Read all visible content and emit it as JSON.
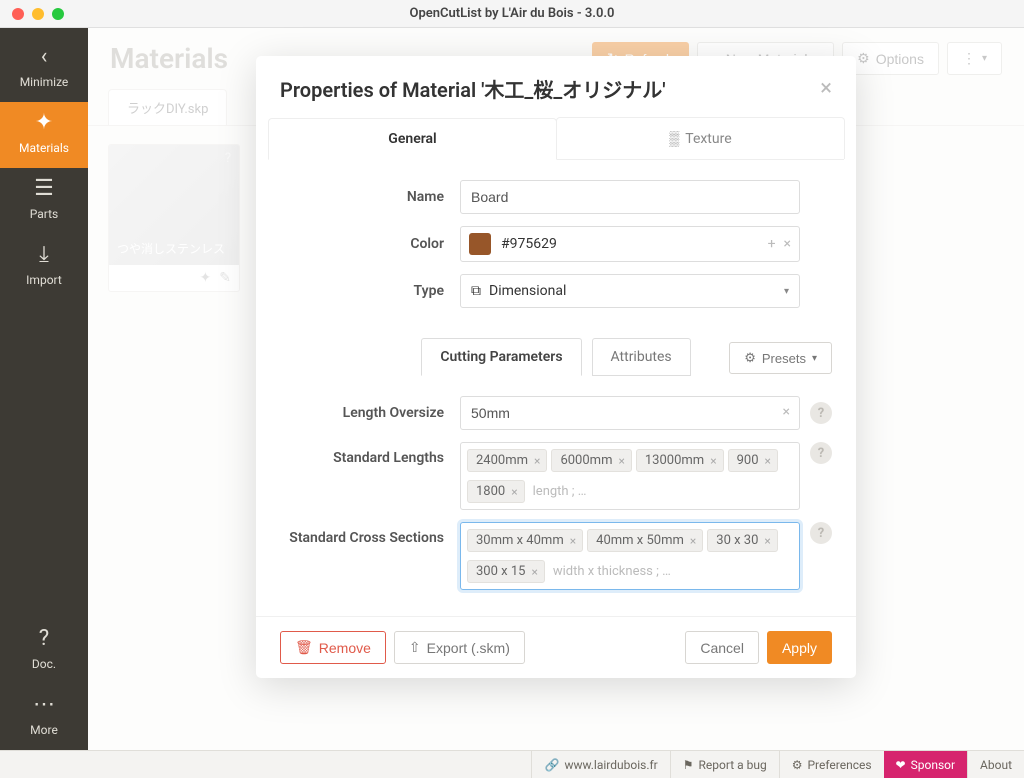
{
  "window": {
    "title": "OpenCutList by L'Air du Bois - 3.0.0"
  },
  "sidebar": {
    "minimize": "Minimize",
    "materials": "Materials",
    "parts": "Parts",
    "import": "Import",
    "doc": "Doc.",
    "more": "More"
  },
  "page": {
    "title": "Materials",
    "refresh": "Refresh",
    "new_material": "New Material...",
    "options": "Options",
    "file_tab": "ラックDIY.skp",
    "material_card_label": "つや消しステンレス"
  },
  "modal": {
    "title": "Properties of Material '木工_桜_オリジナル'",
    "tabs": {
      "general": "General",
      "texture": "Texture"
    },
    "labels": {
      "name": "Name",
      "color": "Color",
      "type": "Type",
      "length_oversize": "Length Oversize",
      "std_lengths": "Standard Lengths",
      "std_cross": "Standard Cross Sections"
    },
    "values": {
      "name": "Board",
      "color_hex": "#975629",
      "type": "Dimensional",
      "length_oversize": "50mm"
    },
    "subtabs": {
      "cutting": "Cutting Parameters",
      "attributes": "Attributes",
      "presets": "Presets"
    },
    "tags_lengths": [
      "2400mm",
      "6000mm",
      "13000mm",
      "900",
      "1800"
    ],
    "lengths_placeholder": "length ; …",
    "tags_cross": [
      "30mm x 40mm",
      "40mm x 50mm",
      "30 x 30",
      "300 x 15"
    ],
    "cross_placeholder": "width x thickness ; …",
    "footer": {
      "remove": "Remove",
      "export": "Export (.skm)",
      "cancel": "Cancel",
      "apply": "Apply"
    }
  },
  "statusbar": {
    "site": "www.lairdubois.fr",
    "bug": "Report a bug",
    "prefs": "Preferences",
    "sponsor": "Sponsor",
    "about": "About"
  }
}
